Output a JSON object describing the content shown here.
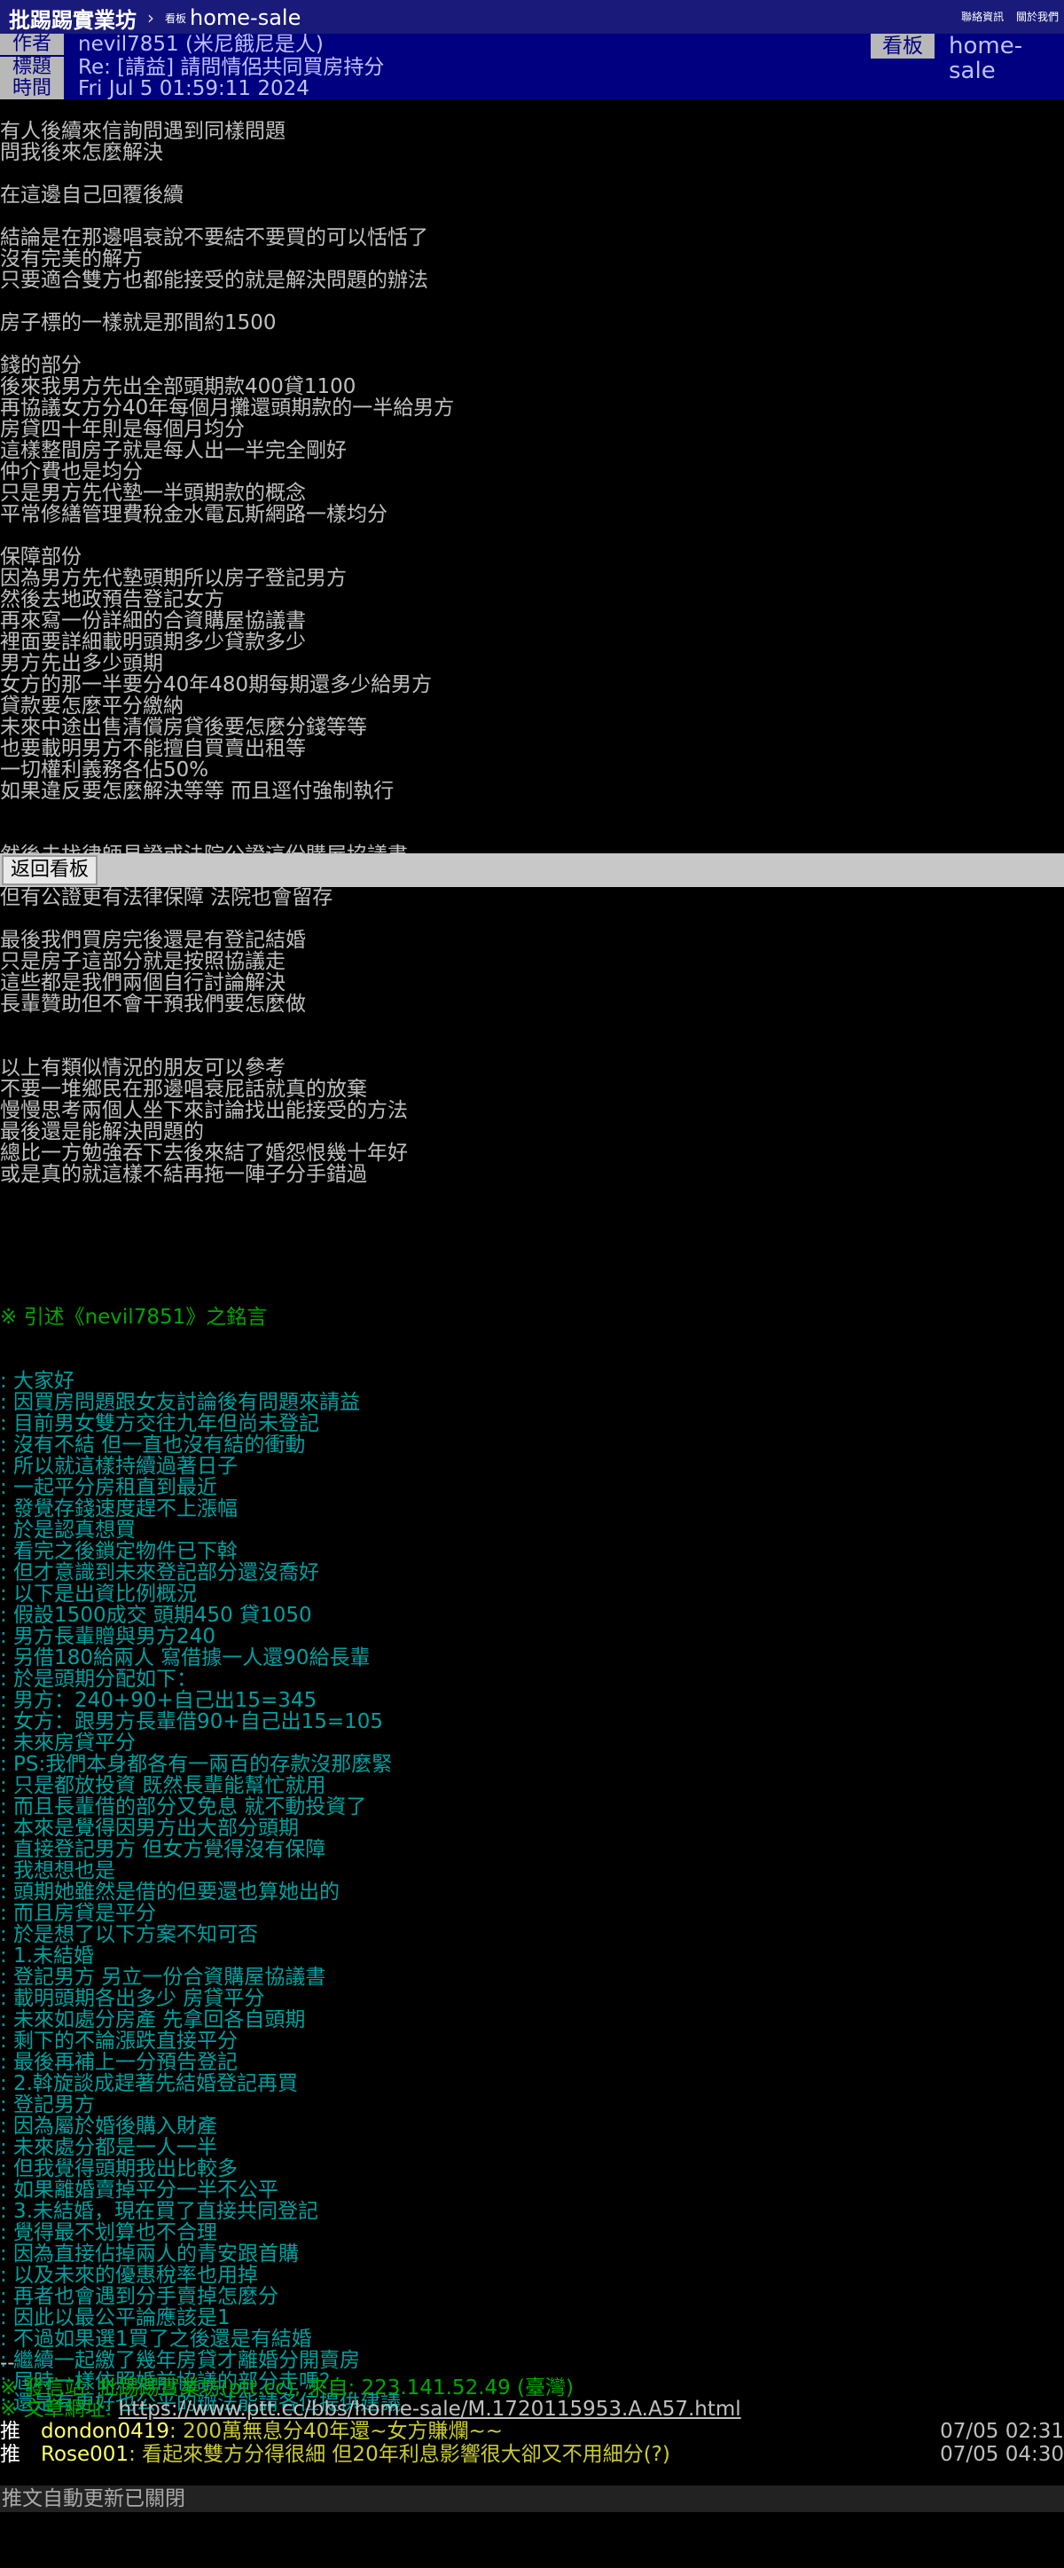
{
  "topbar": {
    "site": "批踢踢實業坊",
    "sep": "›",
    "board_label": "看板",
    "board": "home-sale",
    "links": [
      "聯絡資訊",
      "關於我們"
    ]
  },
  "meta": {
    "author_tag": "作者",
    "author": "nevil7851 (米尼餓尼是人)",
    "title_tag": "標題",
    "title": "Re: [請益] 請問情侶共同買房持分",
    "time_tag": "時間",
    "time": "Fri Jul  5 01:59:11 2024",
    "board_tag": "看板",
    "board": "home-sale"
  },
  "body_part1": "有人後續來信詢問遇到同樣問題\n問我後來怎麼解決\n\n在這邊自己回覆後續\n\n結論是在那邊唱衰說不要結不要買的可以恬恬了\n沒有完美的解方\n只要適合雙方也都能接受的就是解決問題的辦法\n\n房子標的一樣就是那間約1500\n\n錢的部分\n後來我男方先出全部頭期款400貸1100\n再協議女方分40年每個月攤還頭期款的一半給男方\n房貸四十年則是每個月均分\n這樣整間房子就是每人出一半完全剛好\n仲介費也是均分\n只是男方先代墊一半頭期款的概念\n平常修繕管理費稅金水電瓦斯網路一樣均分\n\n保障部份\n因為男方先代墊頭期所以房子登記男方\n然後去地政預告登記女方\n再來寫一份詳細的合資購屋協議書\n裡面要詳細載明頭期多少貸款多少\n男方先出多少頭期\n女方的那一半要分40年480期每期還多少給男方\n貸款要怎麼平分繳納\n未來中途出售清償房貸後要怎麼分錢等等\n也要載明男方不能擅自買賣出租等\n一切權利義務各佔50%\n如果違反要怎麼解決等等 而且逕付強制執行\n\n\n然後去找律師見證或法院公證這份購屋協議書",
  "body_part2": "但有公證更有法律保障 法院也會留存\n\n最後我們買房完後還是有登記結婚\n只是房子這部分就是按照協議走\n這些都是我們兩個自行討論解決\n長輩贊助但不會干預我們要怎麼做\n\n\n以上有類似情況的朋友可以參考\n不要一堆鄉民在那邊唱衰屁話就真的放棄\n慢慢思考兩個人坐下來討論找出能接受的方法\n最後還是能解決問題的\n總比一方勉強吞下去後來結了婚怨恨幾十年好\n或是真的就這樣不結再拖一陣子分手錯過",
  "quote_header": "※ 引述《nevil7851》之銘言",
  "quote_lines": [
    ": 大家好",
    ": 因買房問題跟女友討論後有問題來請益",
    ": 目前男女雙方交往九年但尚未登記",
    ": 沒有不結 但一直也沒有結的衝動",
    ": 所以就這樣持續過著日子",
    ": 一起平分房租直到最近",
    ": 發覺存錢速度趕不上漲幅",
    ": 於是認真想買",
    ": 看完之後鎖定物件已下斡",
    ": 但才意識到未來登記部分還沒喬好",
    ": 以下是出資比例概況",
    ": 假設1500成交 頭期450 貸1050",
    ": 男方長輩贈與男方240",
    ": 另借180給兩人 寫借據一人還90給長輩",
    ": 於是頭期分配如下：",
    ": 男方：240+90+自己出15=345",
    ": 女方：跟男方長輩借90+自己出15=105",
    ": 未來房貸平分",
    ": PS:我們本身都各有一兩百的存款沒那麼緊",
    ": 只是都放投資 既然長輩能幫忙就用",
    ": 而且長輩借的部分又免息 就不動投資了",
    ": 本來是覺得因男方出大部分頭期",
    ": 直接登記男方 但女方覺得沒有保障",
    ": 我想想也是",
    ": 頭期她雖然是借的但要還也算她出的",
    ": 而且房貸是平分",
    ": 於是想了以下方案不知可否",
    ": 1.未結婚",
    ": 登記男方 另立一份合資購屋協議書",
    ": 載明頭期各出多少 房貸平分",
    ": 未來如處分房產 先拿回各自頭期",
    ": 剩下的不論漲跌直接平分",
    ": 最後再補上一分預告登記",
    ": 2.斡旋談成趕著先結婚登記再買",
    ": 登記男方",
    ": 因為屬於婚後購入財產",
    ": 未來處分都是一人一半",
    ": 但我覺得頭期我出比較多",
    ": 如果離婚賣掉平分一半不公平",
    ": 3.未結婚，現在買了直接共同登記",
    ": 覺得最不划算也不合理",
    ": 因為直接佔掉兩人的青安跟首購",
    ": 以及未來的優惠稅率也用掉",
    ": 再者也會遇到分手賣掉怎麼分",
    ": 因此以最公平論應該是1",
    ": 不過如果選1買了之後還是有結婚",
    ": 繼續一起繳了幾年房貸才離婚分開賣房",
    ": 屆時一樣依照婚前協議的部分走嗎？",
    ": 還是有更好也公平的辦法能請各位提供建議"
  ],
  "separator": "--",
  "footer": {
    "origin": "※ 發信站: 批踢踢實業坊(ptt.cc), 來自: 223.141.52.49 (臺灣)",
    "url_label": "※ 文章網址: ",
    "url": "https://www.ptt.cc/bbs/home-sale/M.1720115953.A.A57.html"
  },
  "pushes": [
    {
      "tag": "推",
      "user": "dondon0419",
      "content": ": 200萬無息分40年還~女方賺爛~~",
      "time": "07/05 02:31"
    },
    {
      "tag": "推",
      "user": "Rose001",
      "content": ": 看起來雙方分得很細 但20年利息影響很大卻又不用細分(?)",
      "time": "07/05 04:30"
    }
  ],
  "return_button": "返回看板",
  "auto_update": "推文自動更新已關閉"
}
